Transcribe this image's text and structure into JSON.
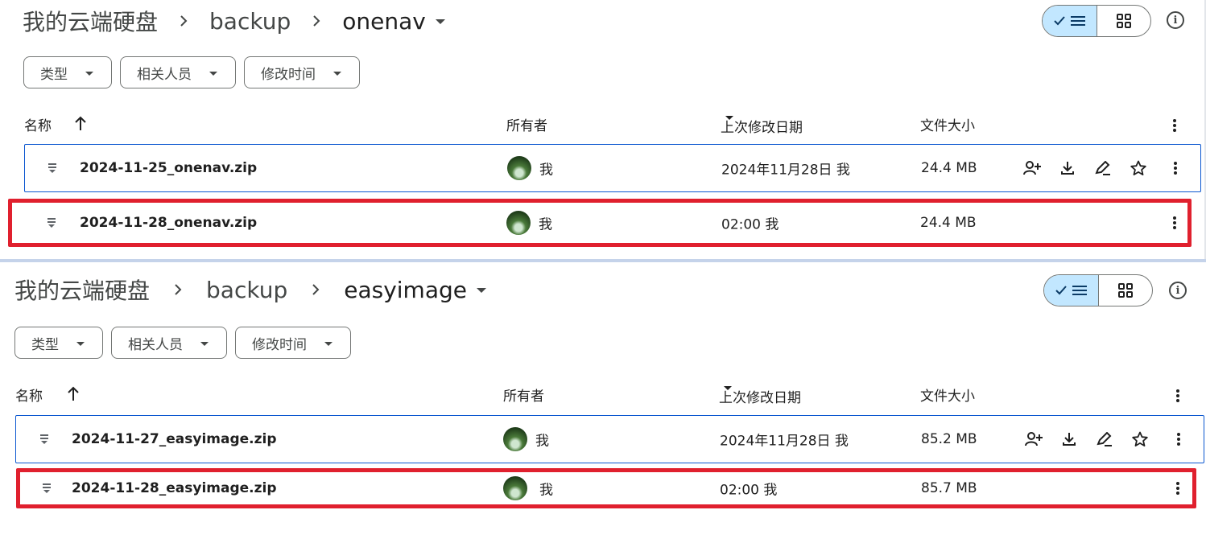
{
  "panels": [
    {
      "breadcrumbs": {
        "root": "我的云端硬盘",
        "folder": "backup",
        "current": "onenav"
      },
      "filters": [
        "类型",
        "相关人员",
        "修改时间"
      ],
      "columns": {
        "name": "名称",
        "owner": "所有者",
        "modified": "上次修改日期",
        "size": "文件大小"
      },
      "rows": [
        {
          "name": "2024-11-25_onenav.zip",
          "owner": "我",
          "modified": "2024年11月28日 我",
          "size": "24.4 MB",
          "selected": true,
          "highlighted": false
        },
        {
          "name": "2024-11-28_onenav.zip",
          "owner": "我",
          "modified": "02:00 我",
          "size": "24.4 MB",
          "selected": false,
          "highlighted": true
        }
      ]
    },
    {
      "breadcrumbs": {
        "root": "我的云端硬盘",
        "folder": "backup",
        "current": "easyimage"
      },
      "filters": [
        "类型",
        "相关人员",
        "修改时间"
      ],
      "columns": {
        "name": "名称",
        "owner": "所有者",
        "modified": "上次修改日期",
        "size": "文件大小"
      },
      "rows": [
        {
          "name": "2024-11-27_easyimage.zip",
          "owner": "我",
          "modified": "2024年11月28日 我",
          "size": "85.2 MB",
          "selected": true,
          "highlighted": false
        },
        {
          "name": "2024-11-28_easyimage.zip",
          "owner": "我",
          "modified": "02:00 我",
          "size": "85.7 MB",
          "selected": false,
          "highlighted": true
        }
      ]
    }
  ],
  "colors": {
    "accent": "#0b57d0",
    "toggle_active": "#c2e7ff",
    "highlight": "#e0202e"
  },
  "icons": [
    "check-icon",
    "list-view-icon",
    "grid-view-icon",
    "info-icon",
    "chevron-right-icon",
    "arrow-up-icon",
    "zip-file-icon",
    "share-person-icon",
    "download-icon",
    "rename-icon",
    "star-icon",
    "more-vert-icon",
    "avatar"
  ]
}
